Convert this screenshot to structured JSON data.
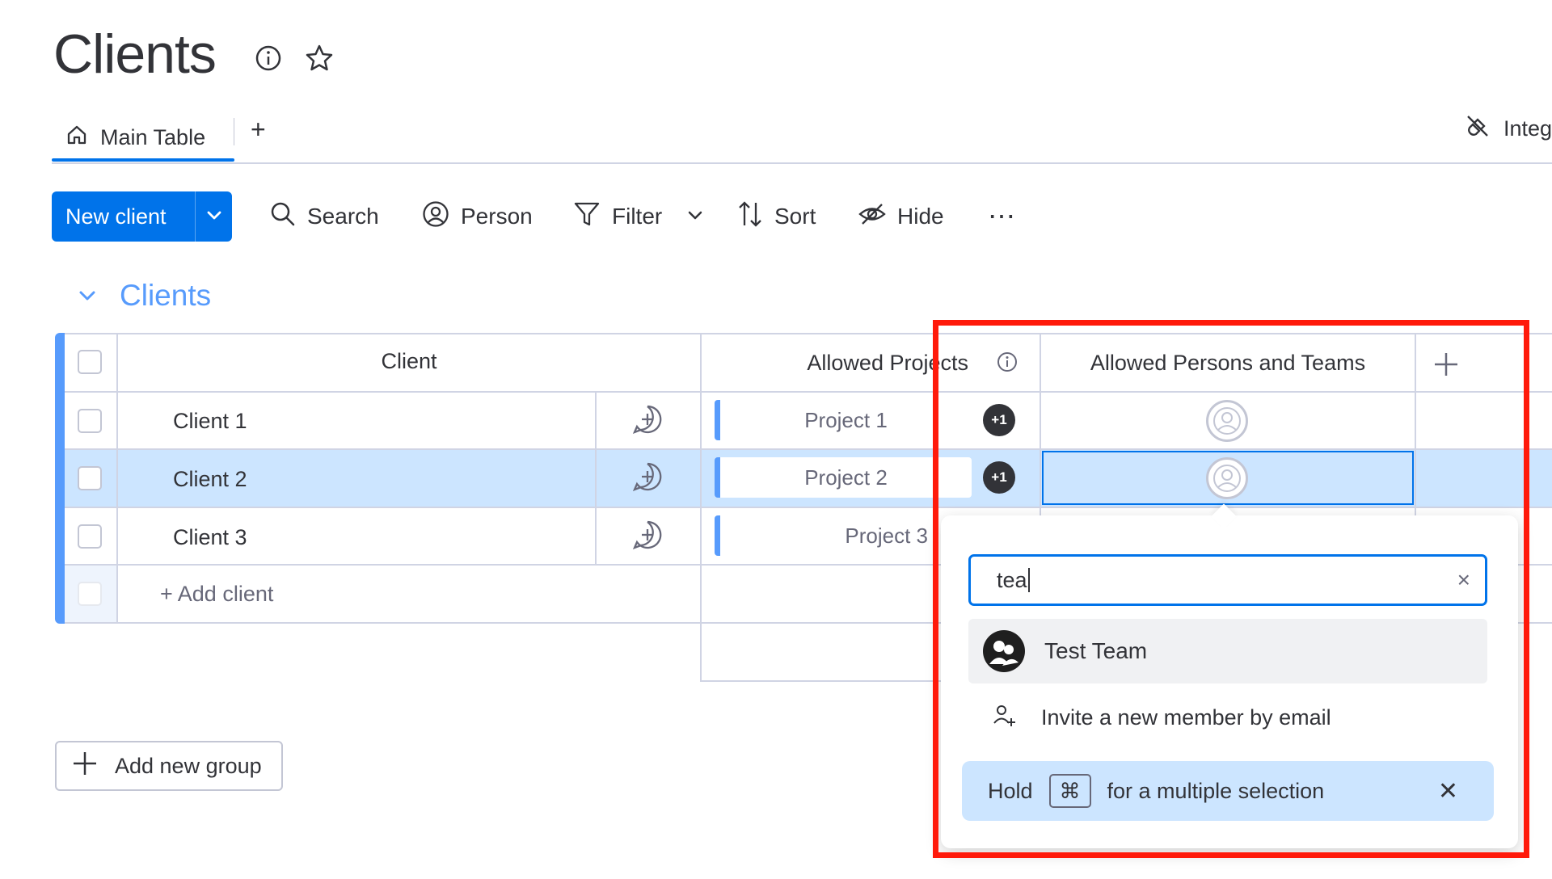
{
  "board": {
    "title": "Clients",
    "info_icon": "info-icon",
    "favorite_icon": "star-icon"
  },
  "tabs": {
    "main_label": "Main Table",
    "main_icon": "home-icon",
    "add_label": "+",
    "integrations_label": "Integ",
    "integrations_icon": "plug-icon"
  },
  "toolbar": {
    "new_label": "New client",
    "search_label": "Search",
    "person_label": "Person",
    "filter_label": "Filter",
    "sort_label": "Sort",
    "hide_label": "Hide",
    "more_label": "⋯"
  },
  "group": {
    "title": "Clients",
    "color": "#579bfc"
  },
  "table": {
    "columns": {
      "client": "Client",
      "projects": "Allowed Projects",
      "persons": "Allowed Persons and Teams"
    },
    "rows": [
      {
        "client": "Client 1",
        "project": "Project 1",
        "extra": "+1",
        "selected": false
      },
      {
        "client": "Client 2",
        "project": "Project 2",
        "extra": "+1",
        "selected": true
      },
      {
        "client": "Client 3",
        "project": "Project 3",
        "extra": "",
        "selected": false
      }
    ],
    "add_row_label": "+ Add client"
  },
  "add_group_label": "Add new group",
  "people_picker": {
    "search_value": "tea",
    "clear_label": "×",
    "results": [
      {
        "name": "Test Team",
        "icon": "team-avatar-icon"
      }
    ],
    "invite_label": "Invite a new member by email",
    "invite_icon": "add-person-icon",
    "hint_prefix": "Hold",
    "hint_key": "⌘",
    "hint_suffix": "for a multiple selection",
    "hint_close": "✕"
  },
  "colors": {
    "accent": "#0073ea",
    "selected_row": "#cce5ff",
    "highlight_box": "#ff1a0b"
  }
}
